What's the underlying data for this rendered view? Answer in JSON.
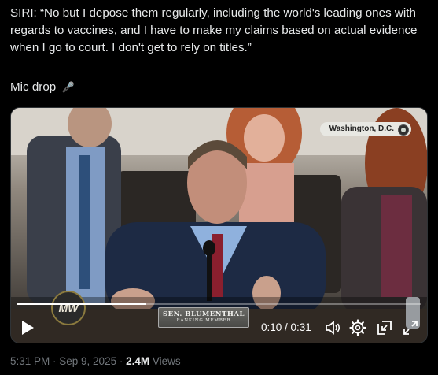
{
  "tweet": {
    "text": "SIRI: “No but I depose them regularly, including the world's leading ones with regards to vaccines, and I have to make my claims based on actual evidence when I go to court. I don't get to rely on titles.”",
    "mic_drop": "Mic drop"
  },
  "video": {
    "location": "Washington, D.C.",
    "logo_text": "MW",
    "nameplate_name": "SEN. BLUMENTHAL",
    "nameplate_role": "RANKING MEMBER",
    "progress_fraction": 0.32,
    "time_display": "0:10 / 0:31"
  },
  "meta": {
    "timestamp": "5:31 PM · Sep 9, 2025 · ",
    "views_count": "2.4M",
    "views_label": " Views"
  },
  "icons": {
    "mic": "microphone-icon",
    "play": "play-icon",
    "volume": "volume-icon",
    "settings": "gear-icon",
    "pip": "picture-in-picture-icon",
    "fullscreen": "fullscreen-icon"
  }
}
